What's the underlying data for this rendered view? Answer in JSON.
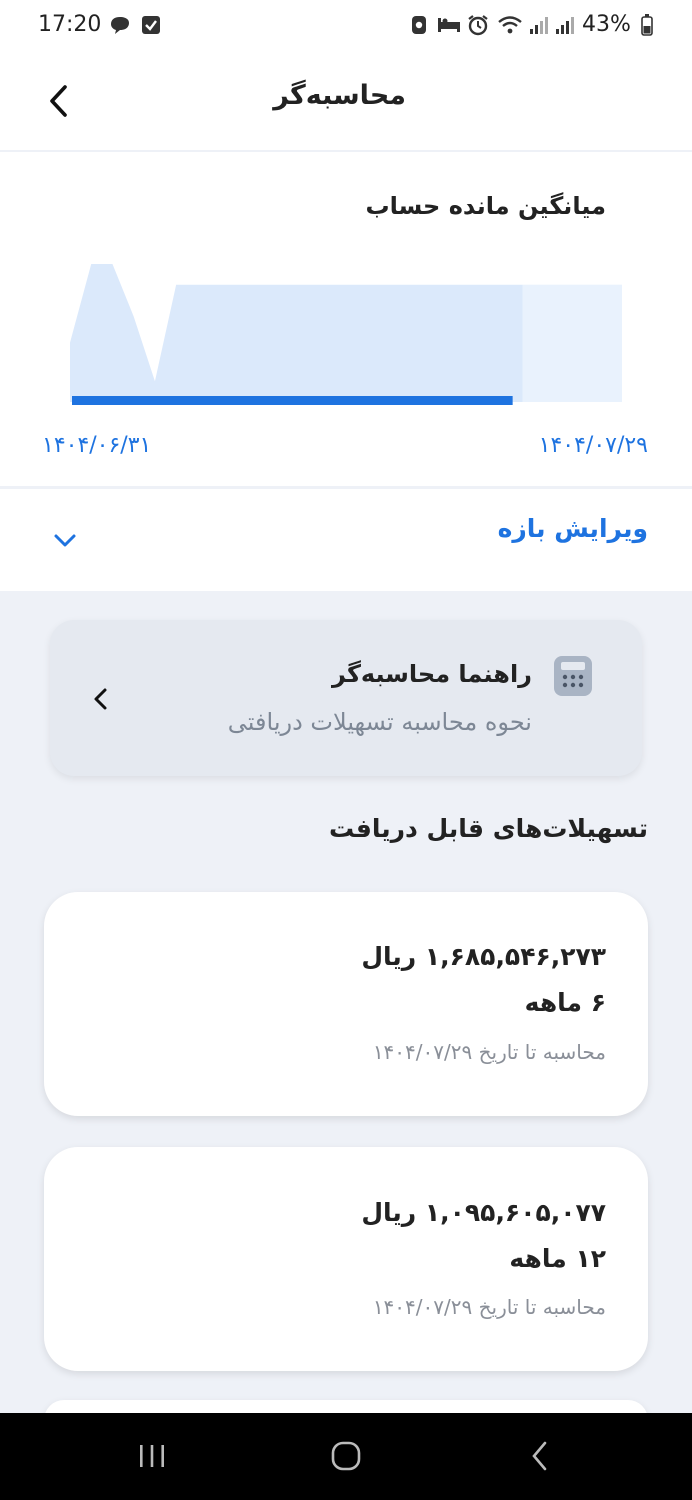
{
  "status_bar": {
    "time": "17:20",
    "battery": "43%",
    "icons": [
      "message-icon",
      "checkbox-icon",
      "app-icon",
      "sleep-icon",
      "alarm-icon",
      "wifi-icon",
      "signal-icon",
      "signal-icon",
      "battery-icon"
    ]
  },
  "header": {
    "title": "محاسبه‌گر",
    "back_icon": "chevron-left-icon"
  },
  "chart": {
    "title": "میانگین مانده حساب",
    "start_date": "۱۴۰۴/۰۶/۳۱",
    "end_date": "۱۴۰۴/۰۷/۲۹"
  },
  "chart_data": {
    "type": "area",
    "title": "میانگین مانده حساب",
    "x_start": "۱۴۰۴/۰۶/۳۱",
    "x_end": "۱۴۰۴/۰۷/۲۹",
    "series": [
      {
        "values": [
          0.43,
          1.0,
          1.0,
          0.62,
          0.15,
          0.85,
          0.85,
          0.85,
          0.85,
          0.85,
          0.85,
          0.85,
          0.85,
          0.85,
          0.85,
          0.85,
          0.85,
          0.85,
          0.85,
          0.85,
          0.85,
          0.85,
          0.85,
          0.85,
          0.85,
          0.85,
          0.85
        ]
      }
    ],
    "selected_range_fraction": 0.82,
    "colors": {
      "area": "#dbe9fb",
      "area_future": "#e9f2fd",
      "range_bar": "#1e73e0"
    }
  },
  "edit_range": {
    "label": "ویرایش بازه",
    "icon": "chevron-down-icon"
  },
  "guide": {
    "title": "راهنما محاسبه‌گر",
    "subtitle": "نحوه محاسبه تسهیلات دریافتی",
    "icon": "calculator-icon"
  },
  "facilities": {
    "heading": "تسهیلات‌های قابل دریافت",
    "items": [
      {
        "amount": "۱,۶۸۵,۵۴۶,۲۷۳ ریال",
        "term": "۶ ماهه",
        "note": "محاسبه تا تاریخ ۱۴۰۴/۰۷/۲۹"
      },
      {
        "amount": "۱,۰۹۵,۶۰۵,۰۷۷ ریال",
        "term": "۱۲ ماهه",
        "note": "محاسبه تا تاریخ ۱۴۰۴/۰۷/۲۹"
      }
    ]
  },
  "colors": {
    "accent": "#1e73e0",
    "page_bg": "#eef1f7"
  }
}
